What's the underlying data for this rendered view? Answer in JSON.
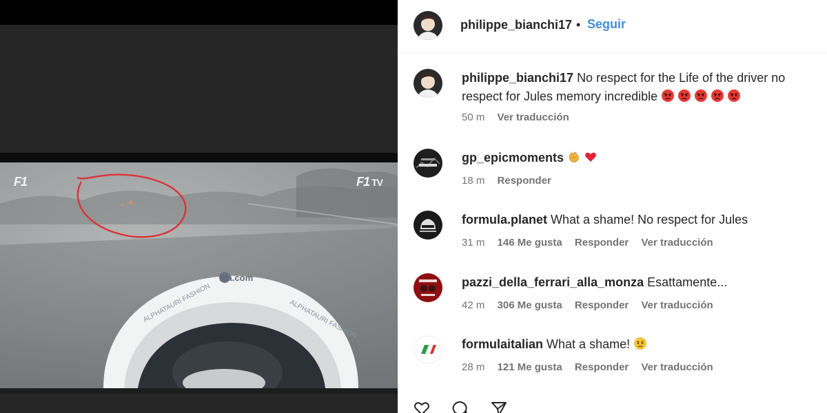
{
  "post": {
    "author": "philippe_bianchi17",
    "separator": "•",
    "follow_label": "Seguir"
  },
  "media": {
    "overlay_logo_left": "F1",
    "overlay_logo_right": "F1",
    "overlay_logo_right_suffix": "TV",
    "sponsor_text": "lifa.com"
  },
  "comments": [
    {
      "username": "philippe_bianchi17",
      "text": "No respect for the Life of the driver no respect for Jules memory incredible",
      "emojis": [
        "angry-face",
        "angry-face",
        "angry-face",
        "angry-face",
        "angry-face"
      ],
      "time": "50 m",
      "likes": "",
      "reply": "",
      "translate": "Ver traducción"
    },
    {
      "username": "gp_epicmoments",
      "text": "",
      "emojis": [
        "clapping-hands",
        "red-heart"
      ],
      "time": "18 m",
      "likes": "",
      "reply": "Responder",
      "translate": ""
    },
    {
      "username": "formula.planet",
      "text": "What a shame! No respect for Jules",
      "emojis": [],
      "time": "31 m",
      "likes": "146 Me gusta",
      "reply": "Responder",
      "translate": "Ver traducción"
    },
    {
      "username": "pazzi_della_ferrari_alla_monza",
      "text": "Esattamente...",
      "emojis": [],
      "time": "42 m",
      "likes": "306 Me gusta",
      "reply": "Responder",
      "translate": "Ver traducción"
    },
    {
      "username": "formulaitalian",
      "text": "What a shame!",
      "emojis": [
        "frowning-face"
      ],
      "time": "28 m",
      "likes": "121 Me gusta",
      "reply": "Responder",
      "translate": "Ver traducción"
    }
  ],
  "icons": {
    "like": "heart-icon",
    "comment": "comment-icon",
    "share": "share-icon"
  },
  "colors": {
    "follow": "#3f8dd6",
    "meta": "#737373",
    "text": "#262626",
    "annotation_circle": "#d9363e"
  }
}
